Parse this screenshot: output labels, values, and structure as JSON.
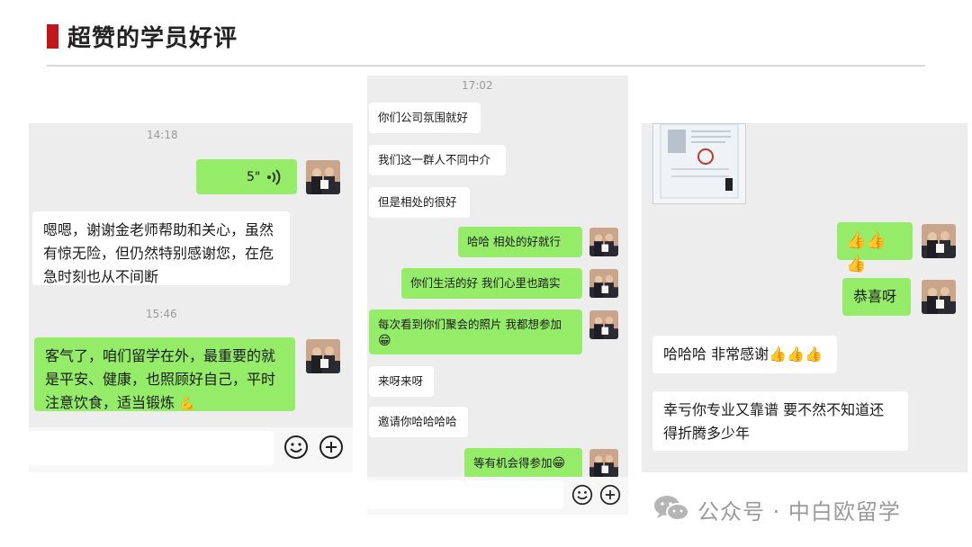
{
  "header": {
    "title": "超赞的学员好评"
  },
  "colors": {
    "accent": "#c0161c",
    "outgoing_bubble": "#95ec69",
    "incoming_bubble": "#ffffff",
    "chat_bg": "#ededed"
  },
  "chat1": {
    "time_1": "14:18",
    "voice_duration": "5\"",
    "msg_in_1_line1": "嗯嗯，谢谢金老师帮助和关心，虽然",
    "msg_in_1_line2": "有惊无险，但仍然特别感谢您，在危",
    "msg_in_1_line3": "急时刻也从不间断",
    "time_2": "15:46",
    "msg_out_2_line1": "客气了，咱们留学在外，最重要的就",
    "msg_out_2_line2": "是平安、健康，也照顾好自己，平时",
    "msg_out_2_line3": "注意饮食，适当锻炼",
    "emoji_name": "muscle-emoji",
    "input_icons": [
      "smiley-icon",
      "plus-icon"
    ]
  },
  "chat2": {
    "time": "17:02",
    "messages": [
      {
        "dir": "in",
        "text": "你们公司氛围就好"
      },
      {
        "dir": "in",
        "text": "我们这一群人不同中介"
      },
      {
        "dir": "in",
        "text": "但是相处的很好"
      },
      {
        "dir": "out",
        "text": "哈哈  相处的好就行"
      },
      {
        "dir": "out",
        "text": "你们生活的好 我们心里也踏实"
      },
      {
        "dir": "out",
        "text": "每次看到你们聚会的照片 我都想参加"
      },
      {
        "dir": "in",
        "text": "来呀来呀"
      },
      {
        "dir": "in",
        "text": "邀请你哈哈哈哈"
      },
      {
        "dir": "out",
        "text": "等有机会得参加"
      }
    ]
  },
  "chat3": {
    "msg_out_2": "恭喜呀",
    "msg_in_1": "哈哈哈 非常感谢",
    "msg_in_2_line1": "幸亏你专业又靠谱  要不然不知道还",
    "msg_in_2_line2": "得折腾多少年"
  },
  "watermark": {
    "text": "公众号 · 中白欧留学"
  }
}
